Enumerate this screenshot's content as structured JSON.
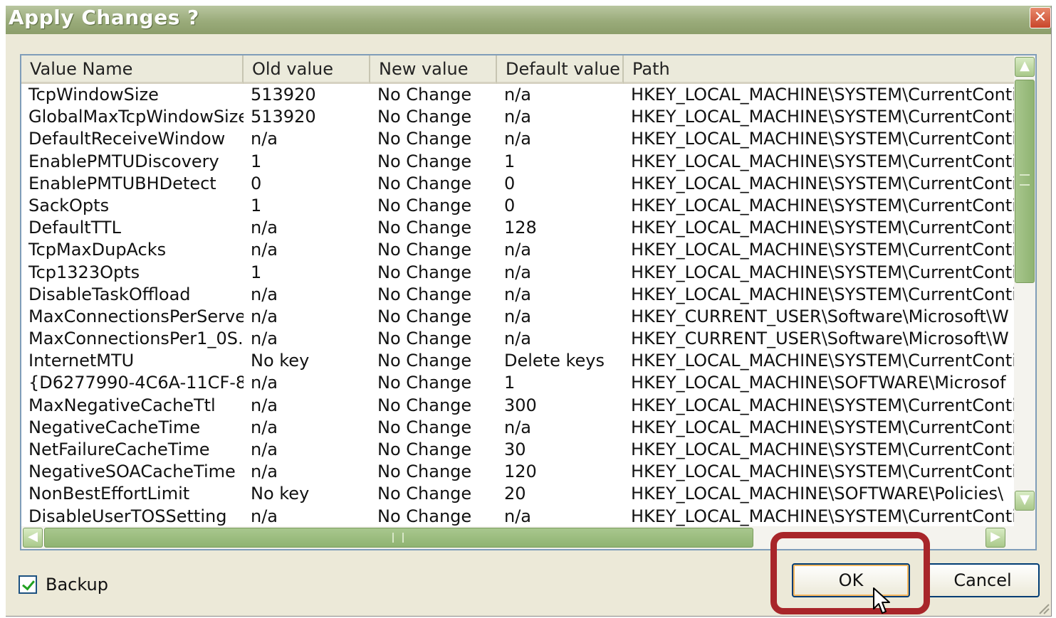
{
  "window": {
    "title": "Apply Changes ?",
    "close_glyph": "✕"
  },
  "columns": [
    "Value Name",
    "Old value",
    "New value",
    "Default value",
    "Path"
  ],
  "rows": [
    [
      "TcpWindowSize",
      "513920",
      "No Change",
      "n/a",
      "HKEY_LOCAL_MACHINE\\SYSTEM\\CurrentConti"
    ],
    [
      "GlobalMaxTcpWindowSize",
      "513920",
      "No Change",
      "n/a",
      "HKEY_LOCAL_MACHINE\\SYSTEM\\CurrentConti"
    ],
    [
      "DefaultReceiveWindow",
      "n/a",
      "No Change",
      "n/a",
      "HKEY_LOCAL_MACHINE\\SYSTEM\\CurrentConti"
    ],
    [
      "EnablePMTUDiscovery",
      "1",
      "No Change",
      "1",
      "HKEY_LOCAL_MACHINE\\SYSTEM\\CurrentConti"
    ],
    [
      "EnablePMTUBHDetect",
      "0",
      "No Change",
      "0",
      "HKEY_LOCAL_MACHINE\\SYSTEM\\CurrentConti"
    ],
    [
      "SackOpts",
      "1",
      "No Change",
      "0",
      "HKEY_LOCAL_MACHINE\\SYSTEM\\CurrentConti"
    ],
    [
      "DefaultTTL",
      "n/a",
      "No Change",
      "128",
      "HKEY_LOCAL_MACHINE\\SYSTEM\\CurrentConti"
    ],
    [
      "TcpMaxDupAcks",
      "n/a",
      "No Change",
      "n/a",
      "HKEY_LOCAL_MACHINE\\SYSTEM\\CurrentConti"
    ],
    [
      "Tcp1323Opts",
      "1",
      "No Change",
      "n/a",
      "HKEY_LOCAL_MACHINE\\SYSTEM\\CurrentConti"
    ],
    [
      "DisableTaskOffload",
      "n/a",
      "No Change",
      "n/a",
      "HKEY_LOCAL_MACHINE\\SYSTEM\\CurrentConti"
    ],
    [
      "MaxConnectionsPerServer",
      "n/a",
      "No Change",
      "n/a",
      "HKEY_CURRENT_USER\\Software\\Microsoft\\W"
    ],
    [
      "MaxConnectionsPer1_0S...",
      "n/a",
      "No Change",
      "n/a",
      "HKEY_CURRENT_USER\\Software\\Microsoft\\W"
    ],
    [
      "InternetMTU",
      "No key",
      "No Change",
      "Delete keys",
      "HKEY_LOCAL_MACHINE\\SYSTEM\\CurrentConti"
    ],
    [
      "{D6277990-4C6A-11CF-8...",
      "n/a",
      "No Change",
      "1",
      "HKEY_LOCAL_MACHINE\\SOFTWARE\\Microsof"
    ],
    [
      "MaxNegativeCacheTtl",
      "n/a",
      "No Change",
      "300",
      "HKEY_LOCAL_MACHINE\\SYSTEM\\CurrentConti"
    ],
    [
      "NegativeCacheTime",
      "n/a",
      "No Change",
      "n/a",
      "HKEY_LOCAL_MACHINE\\SYSTEM\\CurrentConti"
    ],
    [
      "NetFailureCacheTime",
      "n/a",
      "No Change",
      "30",
      "HKEY_LOCAL_MACHINE\\SYSTEM\\CurrentConti"
    ],
    [
      "NegativeSOACacheTime",
      "n/a",
      "No Change",
      "120",
      "HKEY_LOCAL_MACHINE\\SYSTEM\\CurrentConti"
    ],
    [
      "NonBestEffortLimit",
      "No key",
      "No Change",
      "20",
      "HKEY_LOCAL_MACHINE\\SOFTWARE\\Policies\\"
    ],
    [
      "DisableUserTOSSetting",
      "n/a",
      "No Change",
      "n/a",
      "HKEY_LOCAL_MACHINE\\SYSTEM\\CurrentConti"
    ]
  ],
  "scrollbars": {
    "up": "▲",
    "down": "▼",
    "left": "◀",
    "right": "▶"
  },
  "backup": {
    "label": "Backup",
    "checked": true
  },
  "buttons": {
    "ok": "OK",
    "cancel": "Cancel"
  },
  "highlight_color": "#a8262a"
}
